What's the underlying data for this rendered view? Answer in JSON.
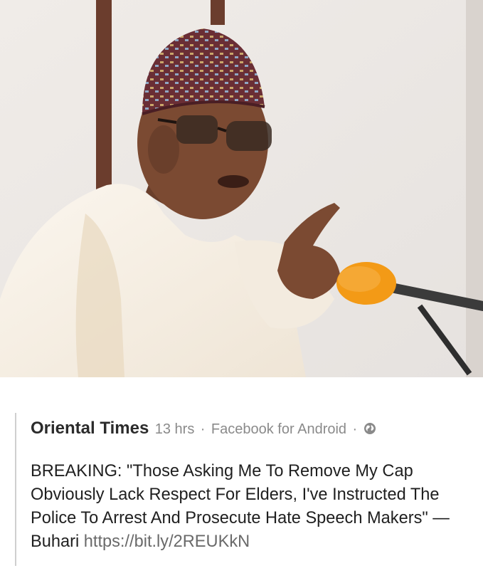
{
  "post": {
    "author": "Oriental Times",
    "time": "13 hrs",
    "source": "Facebook for Android",
    "separator": "·",
    "privacy_icon": "globe-icon",
    "text": "BREAKING: \"Those Asking Me To Remove My Cap Obviously Lack Respect For Elders, I've Instructed The Police To Arrest And Prosecute Hate Speech Makers\" — Buhari",
    "link": "https://bit.ly/2REUKkN"
  },
  "photo": {
    "subject": "man-in-cap-speaking-at-microphone"
  },
  "colors": {
    "author": "#2b2b2b",
    "meta": "#8a8a8a",
    "text": "#1f1f1f",
    "link": "#6a6a6a",
    "mic_foam": "#f39a16",
    "background": "#ece9e6"
  }
}
